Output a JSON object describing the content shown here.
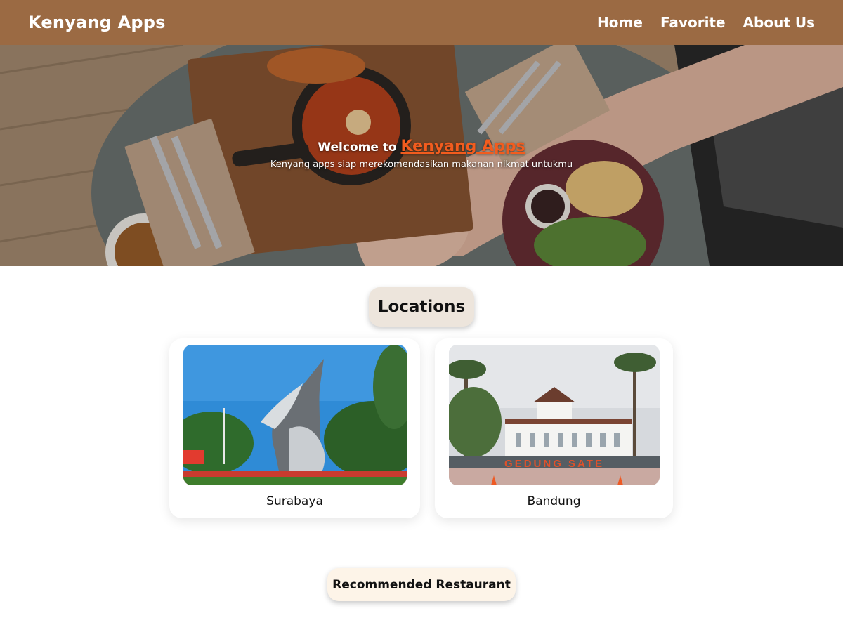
{
  "navbar": {
    "brand": "Kenyang Apps",
    "links": [
      "Home",
      "Favorite",
      "About Us"
    ],
    "background": "#9b6a43"
  },
  "hero": {
    "title_prefix": "Welcome to",
    "title_accent": "Kenyang Apps",
    "subtitle": "Kenyang apps siap merekomendasikan makanan nikmat untukmu",
    "accent_color": "#f25c1e"
  },
  "locations": {
    "heading": "Locations",
    "items": [
      {
        "name": "Surabaya"
      },
      {
        "name": "Bandung",
        "sign_text": "GEDUNG SATE"
      }
    ]
  },
  "recommended": {
    "heading": "Recommended Restaurant"
  }
}
